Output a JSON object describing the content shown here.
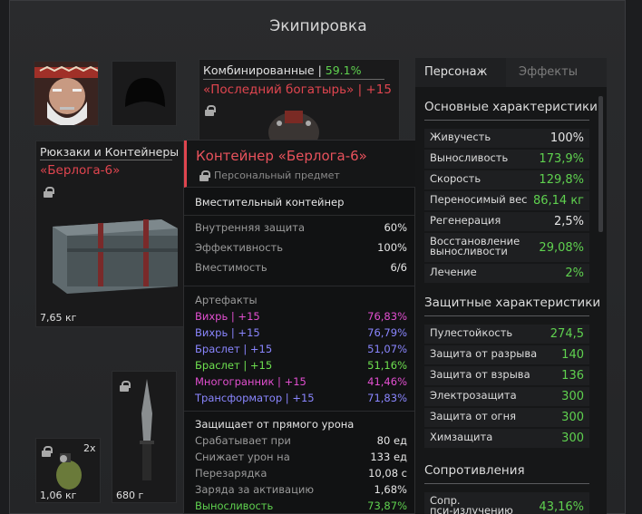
{
  "window": {
    "title": "Экипировка"
  },
  "colors": {
    "accent_red": "#e0454f",
    "green": "#5fd14f"
  },
  "armor": {
    "type_label": "Комбинированные |",
    "type_value": "59.1%",
    "name": "«Последний богатырь» | +15"
  },
  "container": {
    "category": "Рюкзаки и Контейнеры",
    "name": "«Берлога-6»",
    "weight": "7,65 кг"
  },
  "grenade": {
    "count": "2x",
    "weight": "1,06 кг"
  },
  "knife": {
    "weight": "680 г"
  },
  "tooltip": {
    "title": "Контейнер «Берлога-6»",
    "subtitle": "Персональный предмет",
    "kind": "Вместительный контейнер",
    "props": [
      {
        "label": "Внутренняя защита",
        "value": "60%"
      },
      {
        "label": "Эффективность",
        "value": "100%"
      },
      {
        "label": "Вместимость",
        "value": "6/6"
      }
    ],
    "artifacts_title": "Артефакты",
    "artifacts": [
      {
        "label": "Вихрь | +15",
        "value": "76,83%",
        "color": "#e24fd0"
      },
      {
        "label": "Вихрь | +15",
        "value": "76,79%",
        "color": "#8a86ff"
      },
      {
        "label": "Браслет | +15",
        "value": "51,07%",
        "color": "#8a86ff"
      },
      {
        "label": "Браслет | +15",
        "value": "51,16%",
        "color": "#6ee04f"
      },
      {
        "label": "Многогранник | +15",
        "value": "41,46%",
        "color": "#e24fd0"
      },
      {
        "label": "Трансформатор | +15",
        "value": "71,83%",
        "color": "#8a86ff"
      }
    ],
    "protection_title": "Защищает от прямого урона",
    "protection": [
      {
        "label": "Срабатывает при",
        "value": "80 ед"
      },
      {
        "label": "Снижает урон на",
        "value": "133 ед"
      },
      {
        "label": "Перезарядка",
        "value": "10,08 с"
      },
      {
        "label": "Заряда за активацию",
        "value": "1,68%"
      }
    ],
    "last": {
      "label": "Выносливость",
      "value": "73,87%"
    }
  },
  "panel": {
    "tab_active": "Персонаж",
    "tab_inactive": "Эффекты",
    "main_title": "Основные характеристики",
    "main": [
      {
        "label": "Живучесть",
        "value": "100%",
        "color": "#e6e6e6"
      },
      {
        "label": "Выносливость",
        "value": "173,9%",
        "color": "#5fd14f"
      },
      {
        "label": "Скорость",
        "value": "129,8%",
        "color": "#5fd14f"
      },
      {
        "label": "Переносимый вес",
        "value": "86,14 кг",
        "color": "#5fd14f"
      },
      {
        "label": "Регенерация",
        "value": "2,5%",
        "color": "#e6e6e6"
      },
      {
        "label": "Восстановление\nвыносливости",
        "value": "29,08%",
        "color": "#5fd14f"
      },
      {
        "label": "Лечение",
        "value": "2%",
        "color": "#5fd14f"
      }
    ],
    "defense_title": "Защитные характеристики",
    "defense": [
      {
        "label": "Пулестойкость",
        "value": "274,5",
        "color": "#5fd14f"
      },
      {
        "label": "Защита от разрыва",
        "value": "140",
        "color": "#5fd14f"
      },
      {
        "label": "Защита от взрыва",
        "value": "136",
        "color": "#5fd14f"
      },
      {
        "label": "Электрозащита",
        "value": "300",
        "color": "#5fd14f"
      },
      {
        "label": "Защита от огня",
        "value": "300",
        "color": "#5fd14f"
      },
      {
        "label": "Химзащита",
        "value": "300",
        "color": "#5fd14f"
      }
    ],
    "resist_title": "Сопротивления",
    "resist": [
      {
        "label": "Сопр.\nпси-излучению",
        "value": "43,16%",
        "color": "#5fd14f"
      }
    ]
  }
}
